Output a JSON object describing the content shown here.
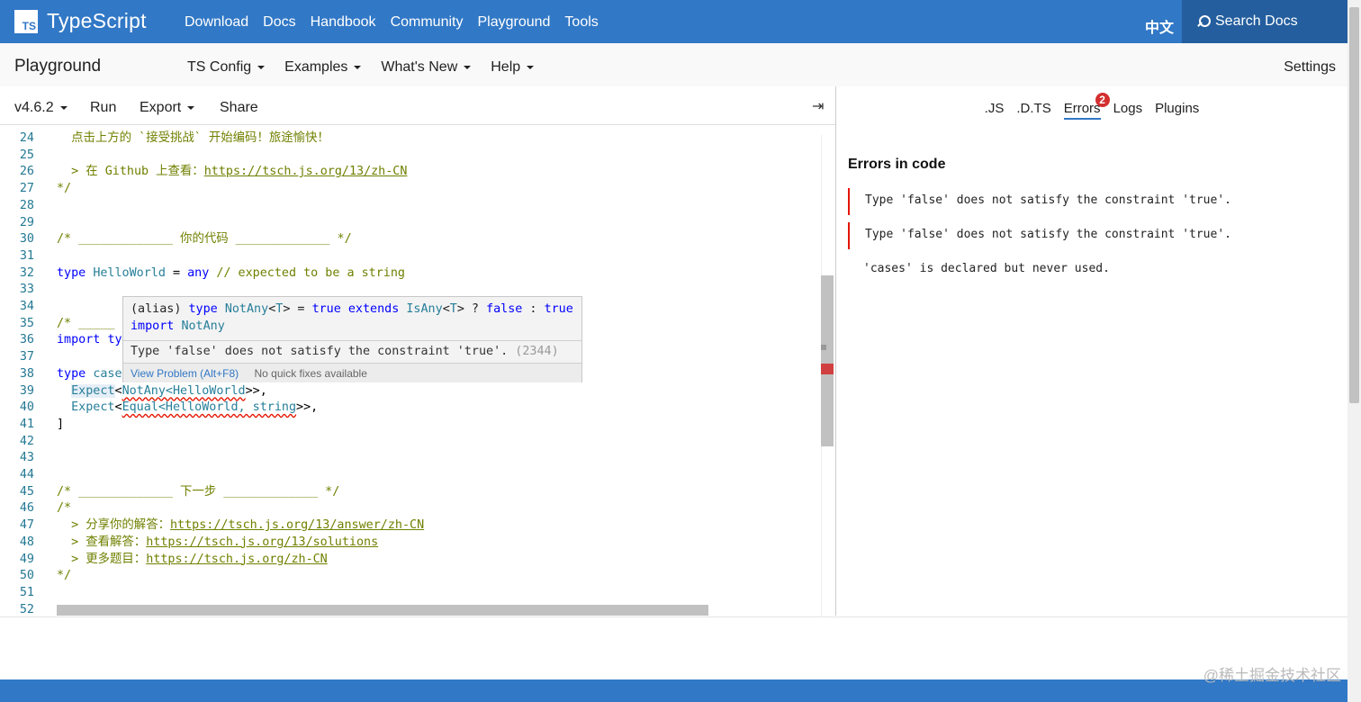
{
  "nav": {
    "brand": "TypeScript",
    "logo": "TS",
    "links": [
      "Download",
      "Docs",
      "Handbook",
      "Community",
      "Playground",
      "Tools"
    ],
    "lang": "中文",
    "search_label": "Search Docs"
  },
  "pgbar": {
    "title": "Playground",
    "menus": [
      "TS Config",
      "Examples",
      "What's New",
      "Help"
    ],
    "settings": "Settings"
  },
  "toolbar": {
    "version": "v4.6.2",
    "run": "Run",
    "export": "Export",
    "share": "Share",
    "collapse": "⇥"
  },
  "editor": {
    "lines": [
      {
        "n": "24",
        "html": "  <span class='cmt'>点击上方的 `接受挑战` 开始编码！旅途愉快！</span>"
      },
      {
        "n": "25",
        "html": ""
      },
      {
        "n": "26",
        "html": "  <span class='cmt'>&gt; 在 Github 上查看：</span><span class='url'>https://tsch.js.org/13/zh-CN</span>"
      },
      {
        "n": "27",
        "html": "<span class='cmt'>*/</span>"
      },
      {
        "n": "28",
        "html": ""
      },
      {
        "n": "29",
        "html": ""
      },
      {
        "n": "30",
        "html": "<span class='cmt'>/* _____________ 你的代码 _____________ */</span>"
      },
      {
        "n": "31",
        "html": ""
      },
      {
        "n": "32",
        "html": "<span class='kw'>type</span> <span class='tp'>HelloWorld</span> = <span class='kw'>any</span> <span class='cmt'>// expected to be a string</span>"
      },
      {
        "n": "33",
        "html": ""
      },
      {
        "n": "34",
        "html": ""
      },
      {
        "n": "35",
        "html": "<span class='cmt'>/* _____</span>"
      },
      {
        "n": "36",
        "html": "<span class='kw'>import</span> <span class='kw'>ty</span>"
      },
      {
        "n": "37",
        "html": ""
      },
      {
        "n": "38",
        "html": "<span class='kw'>type</span> <span class='tp'>case</span>"
      },
      {
        "n": "39",
        "html": "  <span class='tp hlword'>Expect</span>&lt;<span class='tp sq'>NotAny&lt;HelloWorld</span>&gt;&gt;,"
      },
      {
        "n": "40",
        "html": "  <span class='tp'>Expect</span>&lt;<span class='tp sq'>Equal&lt;HelloWorld, string</span>&gt;&gt;,"
      },
      {
        "n": "41",
        "html": "]"
      },
      {
        "n": "42",
        "html": ""
      },
      {
        "n": "43",
        "html": ""
      },
      {
        "n": "44",
        "html": ""
      },
      {
        "n": "45",
        "html": "<span class='cmt'>/* _____________ 下一步 _____________ */</span>"
      },
      {
        "n": "46",
        "html": "<span class='cmt'>/*</span>"
      },
      {
        "n": "47",
        "html": "  <span class='cmt'>&gt; 分享你的解答：</span><span class='url'>https://tsch.js.org/13/answer/zh-CN</span>"
      },
      {
        "n": "48",
        "html": "  <span class='cmt'>&gt; 查看解答：</span><span class='url'>https://tsch.js.org/13/solutions</span>"
      },
      {
        "n": "49",
        "html": "  <span class='cmt'>&gt; 更多题目：</span><span class='url'>https://tsch.js.org/zh-CN</span>"
      },
      {
        "n": "50",
        "html": "<span class='cmt'>*/</span>"
      },
      {
        "n": "51",
        "html": ""
      },
      {
        "n": "52",
        "html": ""
      }
    ]
  },
  "tooltip": {
    "signature_html": "(alias) <span class='kw'>type</span> <span class='tp'>NotAny</span>&lt;<span class='tp'>T</span>&gt; = <span class='kw'>true</span> <span class='kw'>extends</span> <span class='tp'>IsAny</span>&lt;<span class='tp'>T</span>&gt; ? <span class='kw'>false</span> : <span class='kw'>true</span>\n<span class='kw'>import</span> <span class='tp'>NotAny</span>",
    "message": "Type 'false' does not satisfy the constraint 'true'.",
    "code": "(2344)",
    "view_problem": "View Problem (Alt+F8)",
    "no_fixes": "No quick fixes available"
  },
  "panel": {
    "tabs": [
      ".JS",
      ".D.TS",
      "Errors",
      "Logs",
      "Plugins"
    ],
    "errors_badge": "2",
    "heading": "Errors in code",
    "errors": [
      {
        "text": "Type 'false' does not satisfy the constraint 'true'.",
        "kind": "error"
      },
      {
        "text": "Type 'false' does not satisfy the constraint 'true'.",
        "kind": "error"
      },
      {
        "text": "'cases' is declared but never used.",
        "kind": "warning"
      }
    ]
  },
  "watermark": "@稀土掘金技术社区",
  "colors": {
    "brand": "#3178c6",
    "search_bg": "#245e9e",
    "error": "#e51400"
  }
}
